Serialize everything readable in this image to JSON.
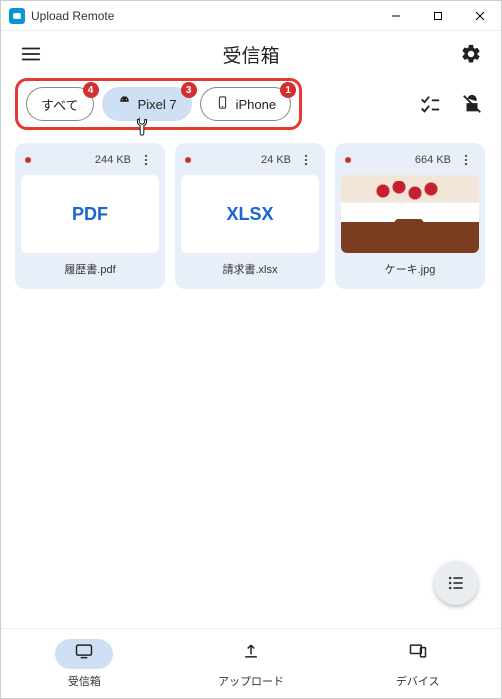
{
  "window": {
    "title": "Upload Remote"
  },
  "header": {
    "page_title": "受信箱"
  },
  "filters": {
    "chips": [
      {
        "label": "すべて",
        "badge": "4",
        "icon": "",
        "active": false
      },
      {
        "label": "Pixel 7",
        "badge": "3",
        "icon": "android",
        "active": true
      },
      {
        "label": "iPhone",
        "badge": "1",
        "icon": "phone",
        "active": false
      }
    ]
  },
  "files": [
    {
      "size": "244 KB",
      "type_label": "PDF",
      "name": "履歴書.pdf",
      "kind": "pdf",
      "unread": true
    },
    {
      "size": "24 KB",
      "type_label": "XLSX",
      "name": "請求書.xlsx",
      "kind": "xlsx",
      "unread": true
    },
    {
      "size": "664 KB",
      "type_label": "",
      "name": "ケーキ.jpg",
      "kind": "image",
      "unread": true
    }
  ],
  "nav": {
    "items": [
      {
        "label": "受信箱",
        "active": true
      },
      {
        "label": "アップロード",
        "active": false
      },
      {
        "label": "デバイス",
        "active": false
      }
    ]
  }
}
